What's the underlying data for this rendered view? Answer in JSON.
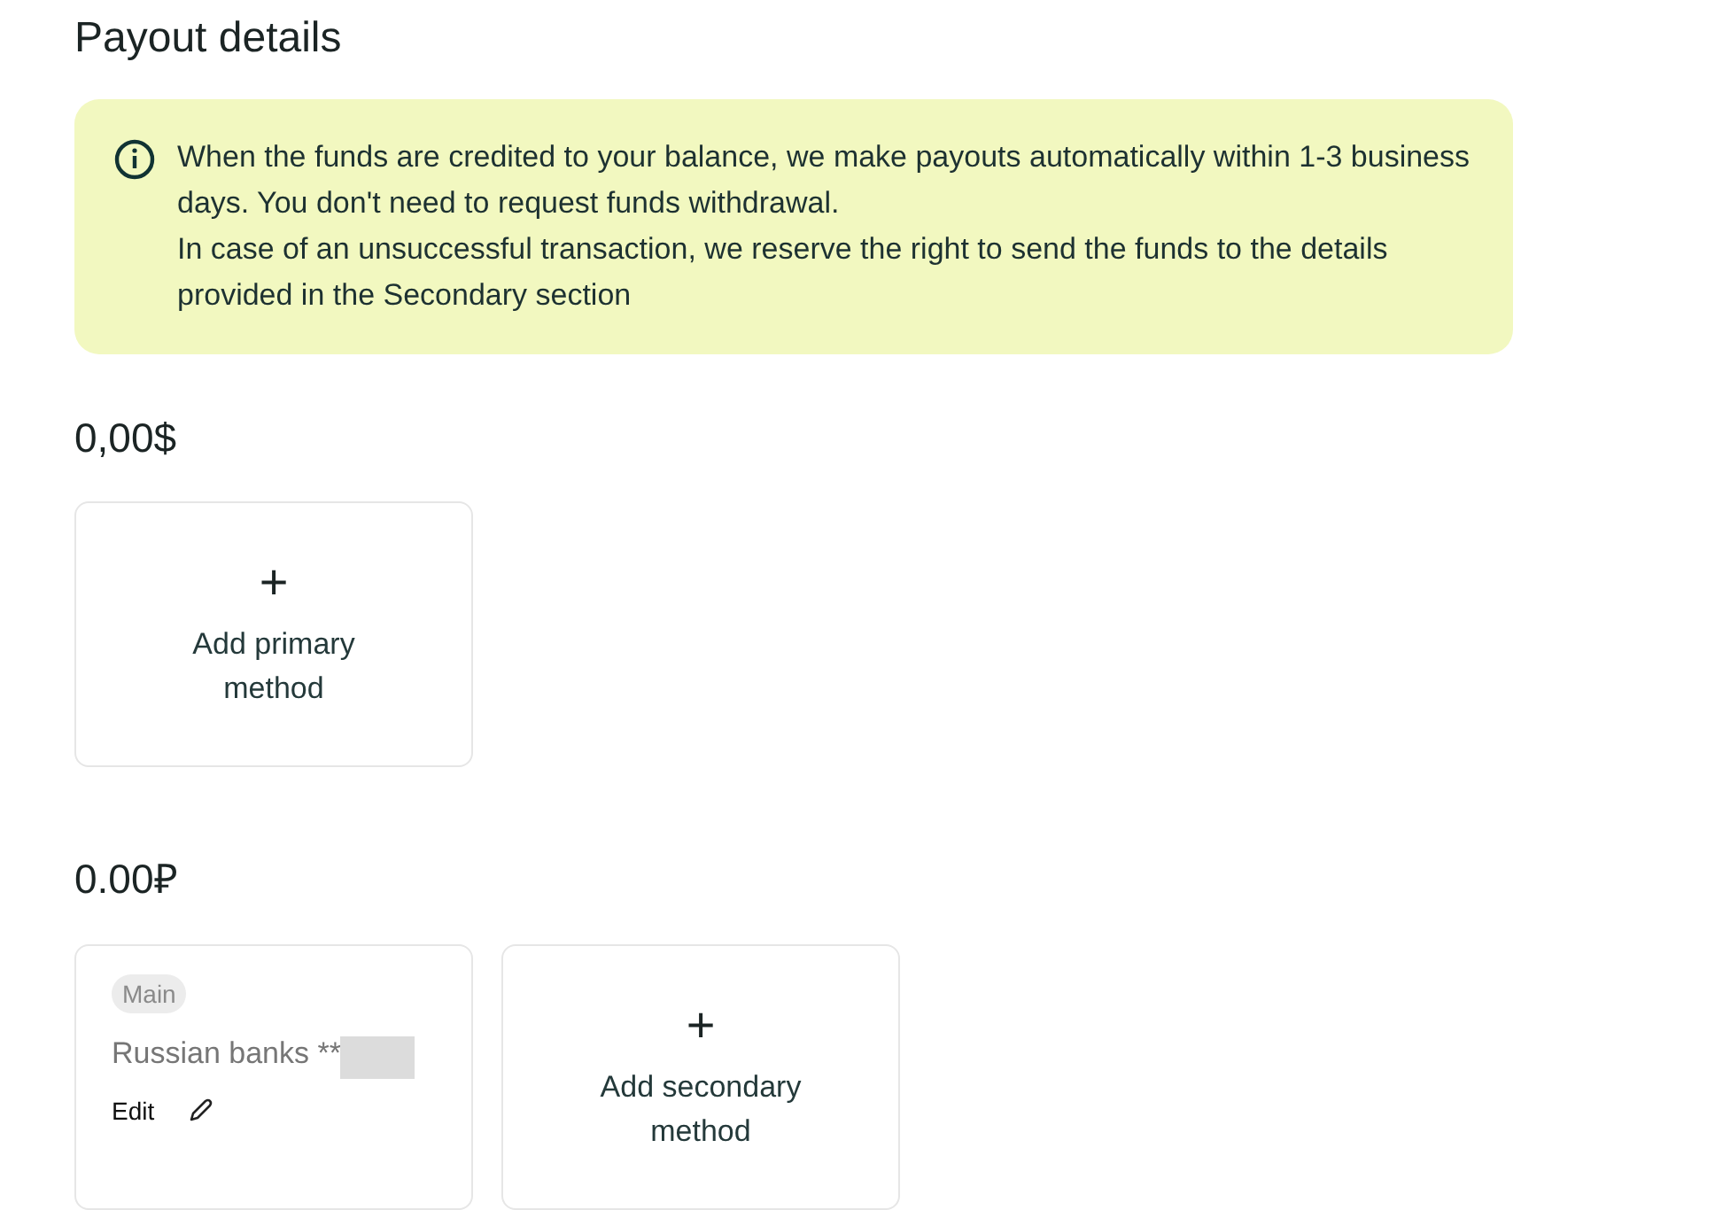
{
  "title": "Payout details",
  "notice": {
    "paragraphs": [
      "When the funds are credited to your balance, we make payouts automatically within 1-3 business days. You don't need to request funds withdrawal.",
      "In case of an unsuccessful transaction, we reserve the right to send the funds to the details provided in the Secondary section"
    ]
  },
  "balances": [
    {
      "amount": "0,00$",
      "cards": [
        {
          "kind": "add",
          "icon": "+",
          "label": "Add primary method"
        }
      ]
    },
    {
      "amount": "0.00₽",
      "cards": [
        {
          "kind": "method",
          "badge": "Main",
          "name": "Russian banks **",
          "redacted": true,
          "edit": "Edit"
        },
        {
          "kind": "add",
          "icon": "+",
          "label": "Add secondary method"
        }
      ]
    }
  ]
}
